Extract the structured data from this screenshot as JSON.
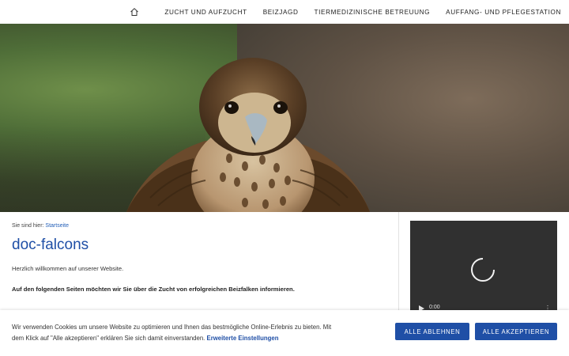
{
  "nav": {
    "home_icon": "home-icon",
    "items": [
      {
        "label": "ZUCHT UND AUFZUCHT"
      },
      {
        "label": "BEIZJAGD"
      },
      {
        "label": "TIERMEDIZINISCHE BETREUUNG"
      },
      {
        "label": "AUFFANG- UND PFLEGESTATION"
      }
    ]
  },
  "breadcrumb": {
    "prefix": "Sie sind hier:",
    "link": "Startseite"
  },
  "main": {
    "title": "doc-falcons",
    "welcome": "Herzlich willkommen auf unserer Website.",
    "intro": "Auf den folgenden Seiten möchten wir Sie über die Zucht von erfolgreichen Beizfalken informieren."
  },
  "video": {
    "time": "0:00"
  },
  "cookie": {
    "text": "Wir verwenden Cookies um unsere Website zu optimieren und Ihnen das bestmögliche Online-Erlebnis zu bieten. Mit dem Klick auf \"Alle akzeptieren\" erklären Sie sich damit einverstanden.",
    "settings_link": "Erweiterte Einstellungen",
    "reject_label": "ALLE ABLEHNEN",
    "accept_label": "ALLE AKZEPTIEREN"
  },
  "colors": {
    "accent": "#1f4fa6",
    "video_bg": "#303030"
  }
}
